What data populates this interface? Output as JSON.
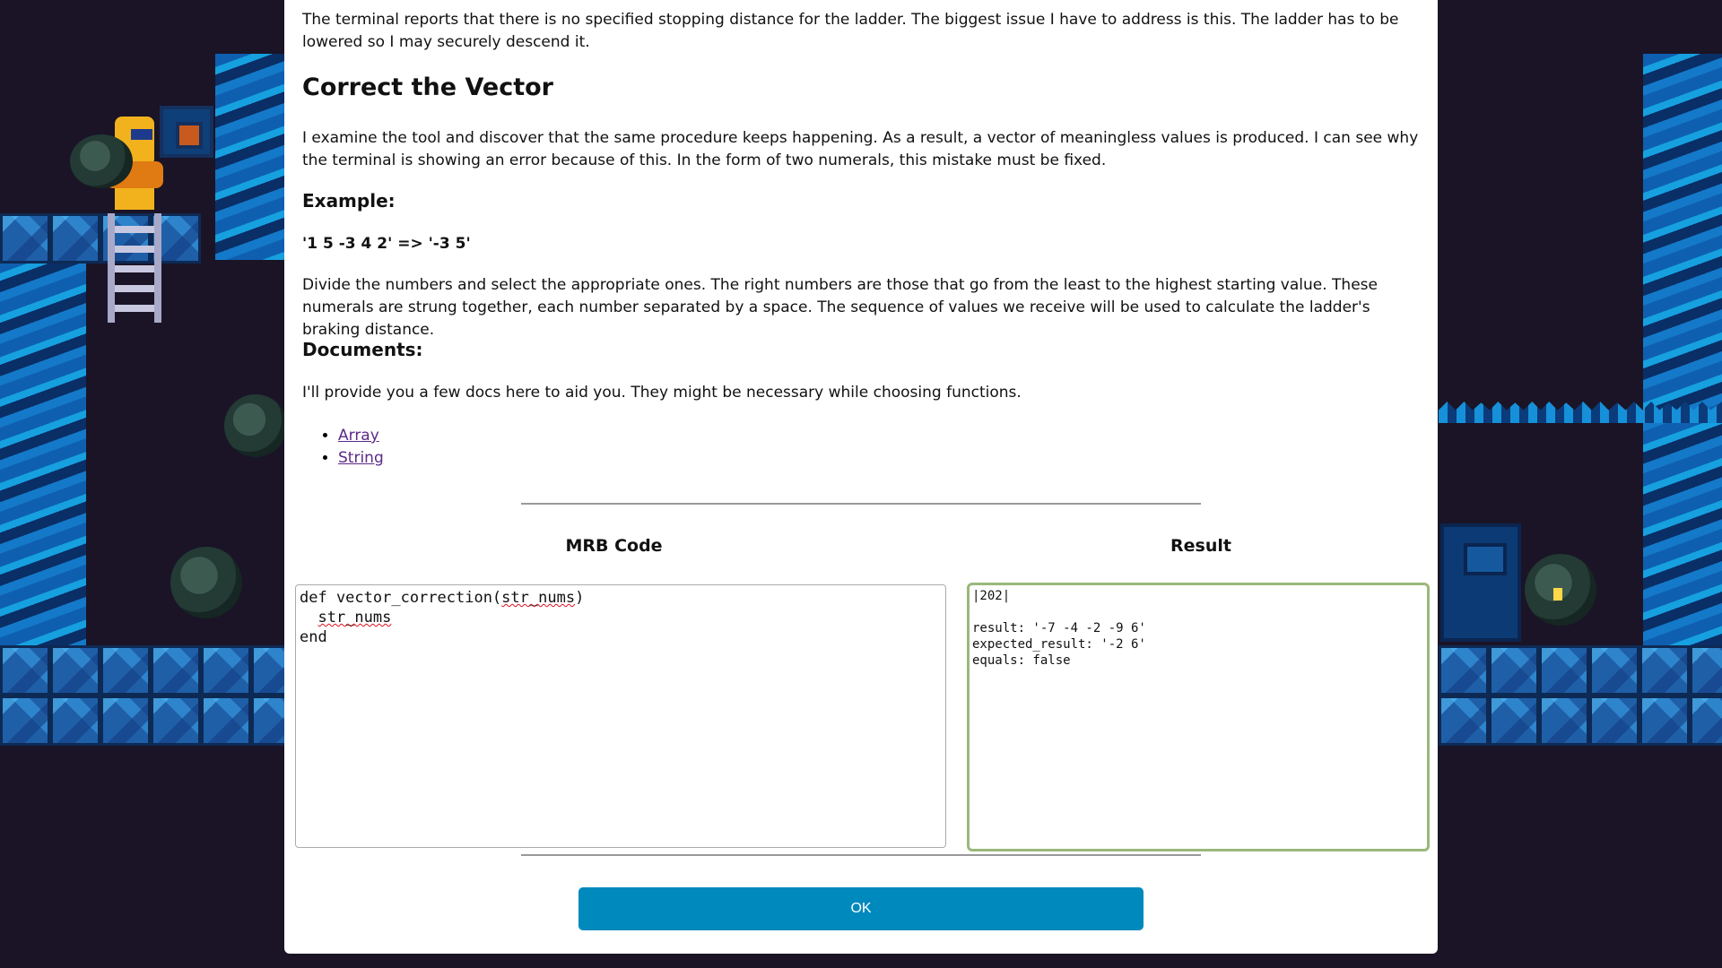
{
  "intro_text": "The terminal reports that there is no specified stopping distance for the ladder. The biggest issue I have to address is this. The ladder has to be lowered so I may securely descend it.",
  "section_title": "Correct the Vector",
  "vector_text": "I examine the tool and discover that the same procedure keeps happening. As a result, a vector of meaningless values is produced. I can see why the terminal is showing an error because of this. In the form of two numerals, this mistake must be fixed.",
  "example_heading": "Example:",
  "example_line": "'1 5 -3 4 2' => '-3 5'",
  "explanation_text": "Divide the numbers and select the appropriate ones. The right numbers are those that go from the least to the highest starting value. These numerals are strung together, each number separated by a space. The sequence of values we receive will be used to calculate the ladder's braking distance.",
  "documents_heading": "Documents:",
  "documents_text": "I'll provide you a few docs here to aid you. They might be necessary while choosing functions.",
  "doc_links": [
    "Array",
    "String"
  ],
  "code_panel": {
    "title": "MRB Code",
    "lines": {
      "l1_prefix": "def vector_correction(",
      "l1_arg": "str_nums",
      "l1_suffix": ")",
      "l2_indent": "  ",
      "l2_body": "str_nums",
      "l3": "end"
    }
  },
  "result_panel": {
    "title": "Result",
    "output": "|202|\n\nresult: '-7 -4 -2 -9 6'\nexpected_result: '-2 6'\nequals: false"
  },
  "ok_button": "OK",
  "colors": {
    "button_bg": "#0089bd",
    "result_border": "#9ab87a",
    "link": "#5b2a86",
    "game_bg": "#1a1426"
  }
}
